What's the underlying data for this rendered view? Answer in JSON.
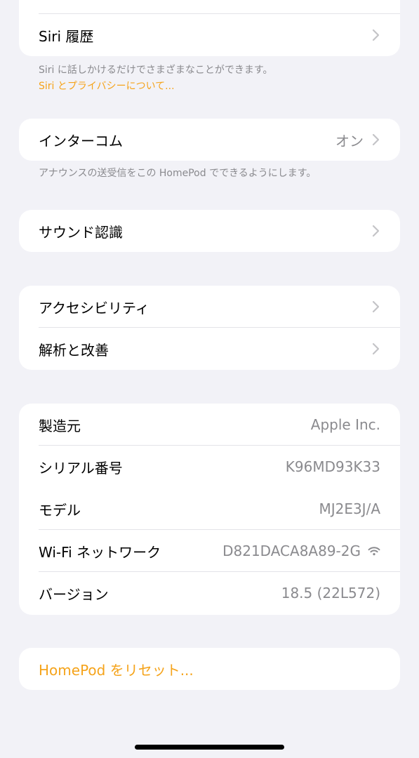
{
  "siri_group": {
    "history_label": "Siri 履歴"
  },
  "siri_footer": {
    "description": "Siri に話しかけるだけでさまざまなことができます。",
    "privacy_link": "Siri とプライバシーについて..."
  },
  "intercom": {
    "label": "インターコム",
    "value": "オン",
    "footer": "アナウンスの送受信をこの HomePod でできるようにします。"
  },
  "sound_recognition": {
    "label": "サウンド認識"
  },
  "accessibility_group": {
    "accessibility_label": "アクセシビリティ",
    "analytics_label": "解析と改善"
  },
  "about": {
    "manufacturer_label": "製造元",
    "manufacturer_value": "Apple Inc.",
    "serial_label": "シリアル番号",
    "serial_value": "K96MD93K33",
    "model_label": "モデル",
    "model_value": "MJ2E3J/A",
    "wifi_label": "Wi-Fi ネットワーク",
    "wifi_value": "D821DACA8A89-2G",
    "version_label": "バージョン",
    "version_value": "18.5 (22L572)"
  },
  "reset": {
    "label": "HomePod をリセット..."
  },
  "colors": {
    "accent": "#f5a31a",
    "background": "#f2f2f7",
    "secondary_text": "#8a8a8e"
  }
}
